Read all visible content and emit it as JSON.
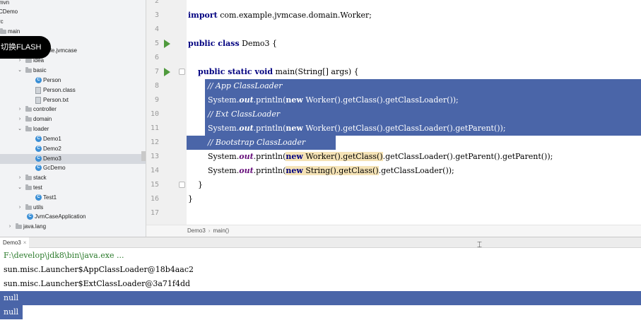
{
  "tree": {
    "items": [
      {
        "label": "mvn",
        "icon": "none",
        "arrow": ""
      },
      {
        "label": "CDemo",
        "icon": "none",
        "arrow": ""
      },
      {
        "label": "rc",
        "icon": "none",
        "arrow": ""
      },
      {
        "label": "main",
        "icon": "folder",
        "arrow": ""
      },
      {
        "label": "mple.jvmcase",
        "icon": "none",
        "arrow": ""
      },
      {
        "label": "idea",
        "icon": "folder",
        "arrow": "›"
      },
      {
        "label": "basic",
        "icon": "folder",
        "arrow": "⌄"
      },
      {
        "label": "Person",
        "icon": "class",
        "arrow": ""
      },
      {
        "label": "Person.class",
        "icon": "file",
        "arrow": ""
      },
      {
        "label": "Person.txt",
        "icon": "file",
        "arrow": ""
      },
      {
        "label": "controller",
        "icon": "folder",
        "arrow": "›"
      },
      {
        "label": "domain",
        "icon": "folder",
        "arrow": "›"
      },
      {
        "label": "loader",
        "icon": "folder",
        "arrow": "⌄"
      },
      {
        "label": "Demo1",
        "icon": "class",
        "arrow": ""
      },
      {
        "label": "Demo2",
        "icon": "class",
        "arrow": ""
      },
      {
        "label": "Demo3",
        "icon": "class",
        "arrow": ""
      },
      {
        "label": "GcDemo",
        "icon": "class",
        "arrow": ""
      },
      {
        "label": "stack",
        "icon": "folder",
        "arrow": "›"
      },
      {
        "label": "test",
        "icon": "folder",
        "arrow": "⌄"
      },
      {
        "label": "Test1",
        "icon": "class",
        "arrow": ""
      },
      {
        "label": "utils",
        "icon": "folder",
        "arrow": "›"
      },
      {
        "label": "JvmCaseApplication",
        "icon": "class",
        "arrow": ""
      },
      {
        "label": "java.lang",
        "icon": "folder",
        "arrow": "›"
      }
    ]
  },
  "overlay": {
    "flash_label": "切换FLASH"
  },
  "editor": {
    "line_numbers": [
      "2",
      "3",
      "4",
      "5",
      "6",
      "7",
      "8",
      "9",
      "10",
      "11",
      "12",
      "13",
      "14",
      "15",
      "16",
      "17"
    ],
    "lines": [
      {
        "text": "",
        "parts": []
      },
      {
        "parts": [
          {
            "t": "import",
            "c": "kw"
          },
          {
            "t": " com.example.jvmcase.domain.Worker;"
          }
        ]
      },
      {
        "parts": []
      },
      {
        "parts": [
          {
            "t": "public class",
            "c": "kw"
          },
          {
            "t": " Demo3 {"
          }
        ]
      },
      {
        "parts": []
      },
      {
        "parts": [
          {
            "t": "    "
          },
          {
            "t": "public static void",
            "c": "kw"
          },
          {
            "t": " main(String[] args) {"
          }
        ]
      },
      {
        "parts": [
          {
            "t": "        "
          },
          {
            "t": "// App ClassLoader",
            "c": "cmt"
          }
        ]
      },
      {
        "parts": [
          {
            "t": "        System."
          },
          {
            "t": "out",
            "c": "fld"
          },
          {
            "t": ".println("
          },
          {
            "t": "new",
            "c": "kw"
          },
          {
            "t": " Worker().getClass().getClassLoader());"
          }
        ]
      },
      {
        "parts": [
          {
            "t": "        "
          },
          {
            "t": "// Ext ClassLoader",
            "c": "cmt"
          }
        ]
      },
      {
        "parts": [
          {
            "t": "        System."
          },
          {
            "t": "out",
            "c": "fld"
          },
          {
            "t": ".println("
          },
          {
            "t": "new",
            "c": "kw"
          },
          {
            "t": " Worker().getClass().getClassLoader().getParent());"
          }
        ]
      },
      {
        "parts": [
          {
            "t": "        "
          },
          {
            "t": "// Bootstrap ClassLoader",
            "c": "cmt"
          }
        ]
      },
      {
        "parts": [
          {
            "t": "        System."
          },
          {
            "t": "out",
            "c": "fld"
          },
          {
            "t": ".println("
          },
          {
            "t": "new",
            "c": "kw",
            "h": true
          },
          {
            "t": " Worker().getClass()",
            "h": true
          },
          {
            "t": ".getClassLoader().getParent().getParent());"
          }
        ]
      },
      {
        "parts": [
          {
            "t": "        System."
          },
          {
            "t": "out",
            "c": "fld"
          },
          {
            "t": ".println("
          },
          {
            "t": "new",
            "c": "kw",
            "h": true
          },
          {
            "t": " String().getClass()",
            "h": true
          },
          {
            "t": ".getClassLoader());"
          }
        ]
      },
      {
        "parts": [
          {
            "t": "    }"
          }
        ]
      },
      {
        "parts": [
          {
            "t": "}"
          }
        ]
      },
      {
        "parts": []
      }
    ]
  },
  "breadcrumb": {
    "class_name": "Demo3",
    "method": "main()"
  },
  "run_panel": {
    "tab_label": "Demo3",
    "tab_close": "×",
    "console": [
      "F:\\develop\\jdk8\\bin\\java.exe ...",
      "sun.misc.Launcher$AppClassLoader@18b4aac2",
      "sun.misc.Launcher$ExtClassLoader@3a71f4dd",
      "null",
      "null"
    ]
  },
  "colors": {
    "selection": "#4a65a8",
    "keyword": "#000080",
    "run_icon": "#4f9a3d"
  }
}
